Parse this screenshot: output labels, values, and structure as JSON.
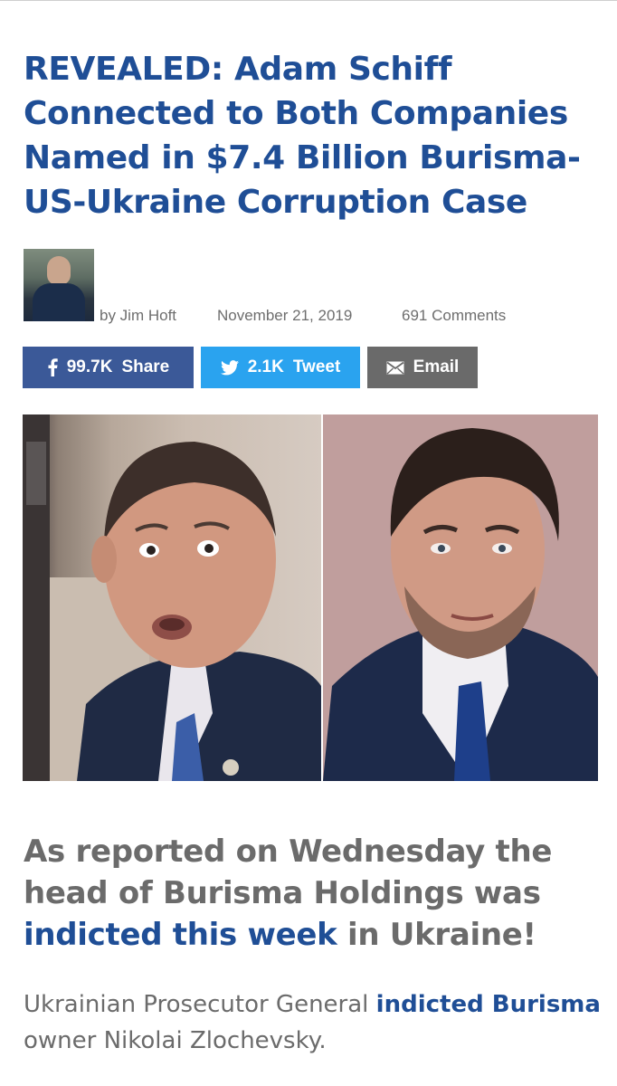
{
  "article": {
    "headline": "REVEALED: Adam Schiff Connected to Both Companies Named in $7.4 Billion Burisma-US-Ukraine Corruption Case"
  },
  "byline": {
    "author": "by Jim Hoft",
    "date": "November 21, 2019",
    "comments": "691 Comments"
  },
  "share": {
    "facebook": {
      "count": "99.7K",
      "label": "Share",
      "icon": "facebook-icon",
      "color": "#3b5998"
    },
    "twitter": {
      "count": "2.1K",
      "label": "Tweet",
      "icon": "twitter-icon",
      "color": "#2aa3ef"
    },
    "email": {
      "label": "Email",
      "icon": "envelope-icon",
      "color": "#6a6a6a"
    }
  },
  "lead": {
    "text_1": "As reported on Wednesday the head of Burisma Holdings was ",
    "link": "indicted this week",
    "text_2": " in Ukraine!"
  },
  "paragraph": {
    "text_1": "Ukrainian Prosecutor General ",
    "link": "indicted Burisma",
    "text_2": " owner Nikolai Zlochevsky."
  },
  "colors": {
    "headline": "#1f4e96",
    "link": "#1f4e96",
    "body_text": "#6b6b6b"
  }
}
